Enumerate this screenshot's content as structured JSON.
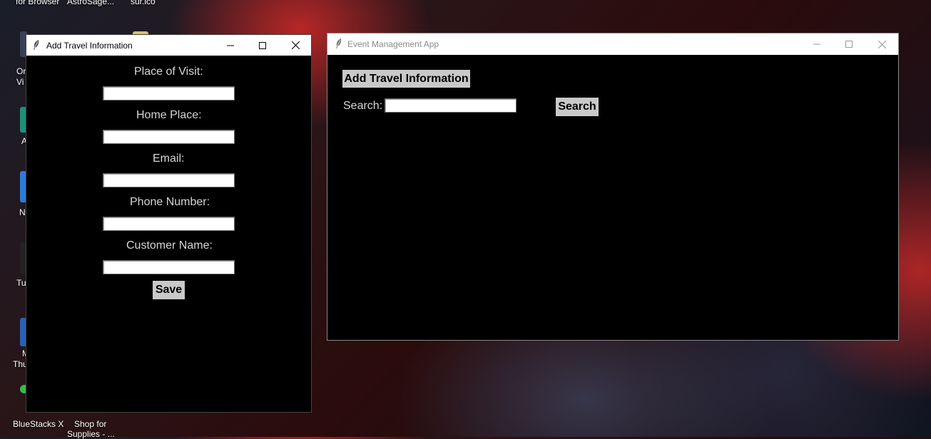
{
  "desktop": {
    "top_labels": [
      "for Browser",
      "AstroSage...",
      "sur.ico"
    ],
    "left_labels": [
      "Or",
      "Vi",
      "A",
      "N",
      "Tu",
      "M",
      "Thu"
    ],
    "bottom_labels": [
      "BlueStacks X",
      "Shop for",
      "Supplies - ..."
    ]
  },
  "travel_window": {
    "title": "Add Travel Information",
    "fields": [
      {
        "label": "Place of Visit:",
        "value": ""
      },
      {
        "label": "Home Place:",
        "value": ""
      },
      {
        "label": "Email:",
        "value": ""
      },
      {
        "label": "Phone Number:",
        "value": ""
      },
      {
        "label": "Customer Name:",
        "value": ""
      }
    ],
    "save_label": "Save"
  },
  "main_window": {
    "title": "Event Management App",
    "add_button_label": "Add Travel Information",
    "search_label": "Search:",
    "search_value": "",
    "search_button_label": "Search"
  },
  "icons": {
    "app": "feather-icon",
    "minimize": "minimize-icon",
    "maximize": "maximize-icon",
    "close": "close-icon"
  }
}
